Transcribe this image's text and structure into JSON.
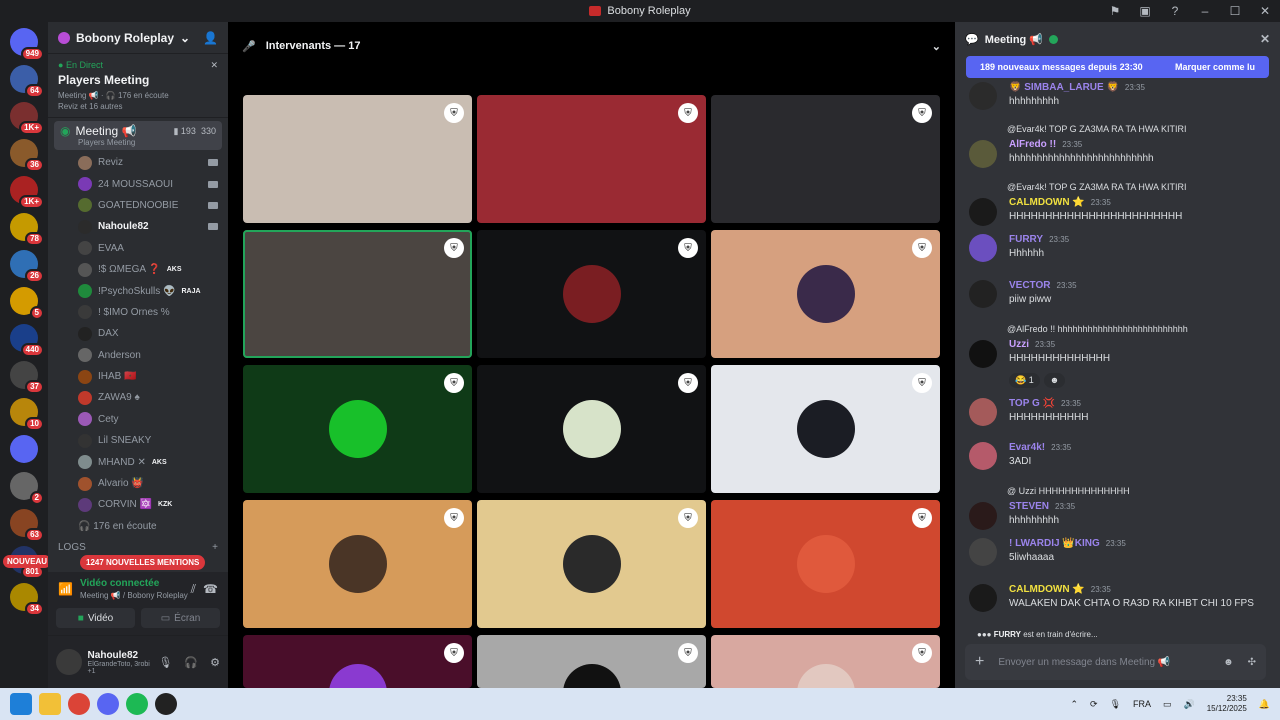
{
  "window": {
    "title": "Bobony Roleplay"
  },
  "rail": {
    "servers": [
      {
        "badge": "949",
        "color": "#5865f2"
      },
      {
        "badge": "64",
        "color": "#3b5ea8"
      },
      {
        "badge": "1K+",
        "color": "#7a2f2f"
      },
      {
        "badge": "36",
        "color": "#8a5a2b"
      },
      {
        "badge": "1K+",
        "color": "#a22"
      },
      {
        "badge": "78",
        "color": "#c59a00"
      },
      {
        "badge": "26",
        "color": "#2f6fb5"
      },
      {
        "badge": "5",
        "color": "#d49b00"
      },
      {
        "badge": "440",
        "color": "#1a3f8a"
      },
      {
        "badge": "37",
        "color": "#444"
      },
      {
        "badge": "10",
        "color": "#b8860b"
      },
      {
        "badge": "",
        "color": "#5865f2"
      },
      {
        "badge": "2",
        "color": "#666"
      },
      {
        "badge": "63",
        "color": "#884422"
      },
      {
        "badge": "801",
        "color": "#223366"
      },
      {
        "badge": "34",
        "color": "#aa8800"
      }
    ],
    "nouveau": "NOUVEAU"
  },
  "sidebar": {
    "server_name": "Bobony Roleplay",
    "event": {
      "live": "En Direct",
      "title": "Players Meeting",
      "sub": "Meeting 📢 · 🎧 176 en écoute",
      "sub2": "Reviz et 16 autres"
    },
    "voice_channel": {
      "name": "Meeting 📢",
      "sub": "Players Meeting",
      "count": "193",
      "cap": "330"
    },
    "users": [
      {
        "name": "Reviz",
        "color": "#8a6d5a",
        "cam": true,
        "tag": ""
      },
      {
        "name": "24 MOUSSAOUI",
        "color": "#7a3ab5",
        "cam": true,
        "tag": ""
      },
      {
        "name": "GOATEDNOOBIE",
        "color": "#556b2f",
        "cam": true,
        "tag": ""
      },
      {
        "name": "Nahoule82",
        "color": "#2b2b2b",
        "cam": true,
        "tag": "",
        "me": true
      },
      {
        "name": "EVAA",
        "color": "#444",
        "cam": false,
        "tag": ""
      },
      {
        "name": "!$ ΩMEGA ❓",
        "color": "#555",
        "cam": false,
        "tag": "AKS"
      },
      {
        "name": "!PsychoSkulls 👽",
        "color": "#1f8a3c",
        "cam": false,
        "tag": "RAJA"
      },
      {
        "name": "! $IMO Ornes %",
        "color": "#3a3a3a",
        "cam": false,
        "tag": ""
      },
      {
        "name": "DAX",
        "color": "#222",
        "cam": false,
        "tag": ""
      },
      {
        "name": "Anderson",
        "color": "#666",
        "cam": false,
        "tag": ""
      },
      {
        "name": "IHAB 🇲🇦",
        "color": "#8b4513",
        "cam": false,
        "tag": ""
      },
      {
        "name": "ZAWA9 ♠",
        "color": "#c0392b",
        "cam": false,
        "tag": ""
      },
      {
        "name": "Cety",
        "color": "#9b59b6",
        "cam": false,
        "tag": ""
      },
      {
        "name": "Lil SNEAKY",
        "color": "#333",
        "cam": false,
        "tag": ""
      },
      {
        "name": "MHAND ✕",
        "color": "#7f8c8d",
        "cam": false,
        "tag": "AKS"
      },
      {
        "name": "Alvario 👹",
        "color": "#a0522d",
        "cam": false,
        "tag": ""
      },
      {
        "name": "CORVIN 🔯",
        "color": "#5d3a7a",
        "cam": false,
        "tag": "KZK"
      }
    ],
    "listening": "176 en écoute",
    "logs": "LOGS",
    "mentions": "1247 NOUVELLES MENTIONS",
    "voice_panel": {
      "status": "Vidéo connectée",
      "sub": "Meeting 📢 / Bobony Roleplay",
      "video": "Vidéo",
      "screen": "Écran"
    },
    "user_panel": {
      "name": "Nahoule82",
      "status": "ElGrandeToto, 3robi +1"
    }
  },
  "stage": {
    "speakers_label": "Intervenants — 17",
    "tiles": [
      {
        "bg": "#c9bdb2",
        "avatar": "",
        "speaking": false
      },
      {
        "bg": "#9a2a33",
        "avatar": "",
        "speaking": false
      },
      {
        "bg": "#2a2a2e",
        "avatar": "",
        "speaking": false
      },
      {
        "bg": "#4b4541",
        "avatar": "",
        "speaking": true
      },
      {
        "bg": "#111214",
        "avatar": "#7a1e22",
        "speaking": false
      },
      {
        "bg": "#d6a07f",
        "avatar": "#3a2a4a",
        "speaking": false
      },
      {
        "bg": "#0f3a17",
        "avatar": "#18c02a",
        "speaking": false
      },
      {
        "bg": "#111214",
        "avatar": "#d7e3c9",
        "speaking": false
      },
      {
        "bg": "#e4e7ec",
        "avatar": "#1b1d24",
        "speaking": false
      },
      {
        "bg": "#d69b5a",
        "avatar": "#4a3526",
        "speaking": false
      },
      {
        "bg": "#e2c98f",
        "avatar": "#2a2a2a",
        "speaking": false
      },
      {
        "bg": "#d0482f",
        "avatar": "#e0593c",
        "speaking": false
      },
      {
        "bg": "#4a0e2a",
        "avatar": "#8a3ad0",
        "speaking": false
      },
      {
        "bg": "#a8a8a8",
        "avatar": "#111",
        "speaking": false
      },
      {
        "bg": "#d8a8a0",
        "avatar": "#e2c8c0",
        "speaking": false
      }
    ]
  },
  "chat": {
    "title": "Meeting 📢",
    "new_banner": "189 nouveaux messages depuis 23:30",
    "mark_read": "Marquer comme lu",
    "messages": [
      {
        "avatar": "#2b2b2b",
        "name": "🦁 SIMBAA_LARUE 🦁",
        "name_color": "#9b84ec",
        "time": "23:35",
        "reply": "",
        "body": "hhhhhhhhh"
      },
      {
        "avatar": "#5a5a3a",
        "name": "AlFredo !!",
        "name_color": "#c9a0ff",
        "time": "23:35",
        "reply": "@Evar4k! TOP G ZA3MA RA TA HWA KITIRI",
        "body": "hhhhhhhhhhhhhhhhhhhhhhhhhh"
      },
      {
        "avatar": "#1a1a1a",
        "name": "CALMDOWN ⭐",
        "name_color": "#f0e040",
        "time": "23:35",
        "reply": "@Evar4k! TOP G ZA3MA RA TA HWA KITIRI",
        "body": "HHHHHHHHHHHHHHHHHHHHHHHH"
      },
      {
        "avatar": "#6b4fbf",
        "name": "FURRY",
        "name_color": "#9b84ec",
        "time": "23:35",
        "reply": "",
        "body": "Hhhhhh"
      },
      {
        "avatar": "#222",
        "name": "VECTOR",
        "name_color": "#9b84ec",
        "time": "23:35",
        "reply": "",
        "body": "piiw piww"
      },
      {
        "avatar": "#111",
        "name": "Uzzi",
        "name_color": "#c9a0ff",
        "time": "23:35",
        "reply": "@AlFredo !! hhhhhhhhhhhhhhhhhhhhhhhhhh",
        "body": "HHHHHHHHHHHHHH"
      },
      {
        "avatar": "#a45a5a",
        "name": "TOP G 💢",
        "name_color": "#9b84ec",
        "time": "23:35",
        "reply": "",
        "body": "HHHHHHHHHHH"
      },
      {
        "avatar": "#b55a6a",
        "name": "Evar4k!",
        "name_color": "#9b84ec",
        "time": "23:35",
        "reply": "",
        "body": "3ADI"
      },
      {
        "avatar": "#2a1a1a",
        "name": "STEVEN",
        "name_color": "#9b84ec",
        "time": "23:35",
        "reply": "@ Uzzi HHHHHHHHHHHHHH",
        "body": "hhhhhhhhh"
      },
      {
        "avatar": "#444",
        "name": "! LWARDIJ 👑KING",
        "name_color": "#9b84ec",
        "time": "23:35",
        "reply": "",
        "body": "5liwhaaaa"
      },
      {
        "avatar": "#1a1a1a",
        "name": "CALMDOWN ⭐",
        "name_color": "#f0e040",
        "time": "23:35",
        "reply": "",
        "body": "WALAKEN DAK CHTA O RA3D RA KIHBT CHI 10 FPS"
      }
    ],
    "reaction": "😂 1",
    "typing_name": "FURRY",
    "typing_text": "est en train d'écrire...",
    "input_placeholder": "Envoyer un message dans Meeting 📢"
  },
  "taskbar": {
    "lang": "FRA",
    "time": "23:35",
    "date": "15/12/2025"
  }
}
